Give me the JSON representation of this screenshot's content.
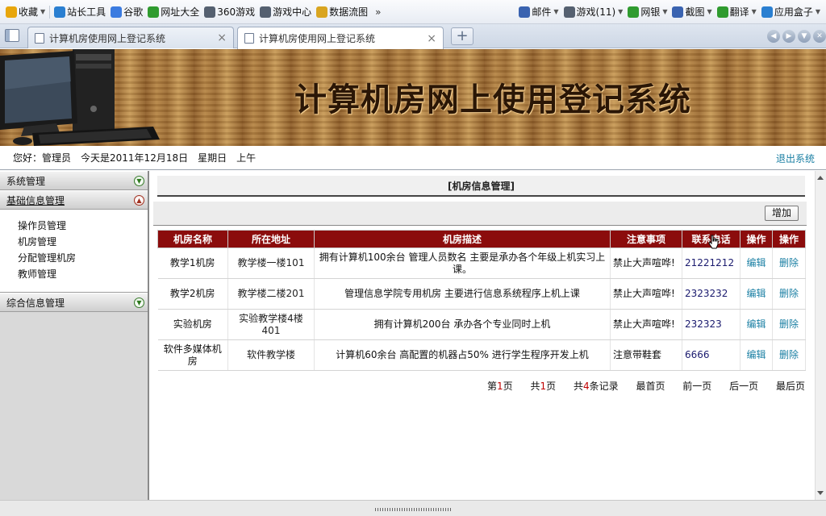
{
  "bookmarks": {
    "left": [
      {
        "label": "收藏",
        "icon": "star-icon",
        "color": "#e8a60c",
        "dropdown": true
      },
      {
        "label": "站长工具",
        "icon": "tool-icon",
        "color": "#2a7fd1",
        "dropdown": false
      },
      {
        "label": "谷歌",
        "icon": "google-icon",
        "color": "#3b7be0",
        "dropdown": false
      },
      {
        "label": "网址大全",
        "icon": "globe-icon",
        "color": "#2f9b2f",
        "dropdown": false
      },
      {
        "label": "360游戏",
        "icon": "gamepad-icon",
        "color": "#556070",
        "dropdown": false
      },
      {
        "label": "游戏中心",
        "icon": "gamepad-icon",
        "color": "#556070",
        "dropdown": false
      },
      {
        "label": "数据流图",
        "icon": "folder-icon",
        "color": "#d9a520",
        "dropdown": false
      }
    ],
    "more": "»",
    "right": [
      {
        "label": "邮件",
        "icon": "mail-icon",
        "color": "#3a63b0"
      },
      {
        "label": "游戏(11)",
        "icon": "gamepad-icon",
        "color": "#556070"
      },
      {
        "label": "网银",
        "icon": "bank-icon",
        "color": "#2f9b2f"
      },
      {
        "label": "截图",
        "icon": "scissors-icon",
        "color": "#3a63b0"
      },
      {
        "label": "翻译",
        "icon": "translate-icon",
        "color": "#2f9b2f"
      },
      {
        "label": "应用盒子",
        "icon": "box-icon",
        "color": "#2a7fd1"
      }
    ]
  },
  "tabs": [
    {
      "label": "计算机房使用网上登记系统",
      "active": false
    },
    {
      "label": "计算机房使用网上登记系统",
      "active": true
    }
  ],
  "tab_controls": {
    "new_tab": "+",
    "close": "×"
  },
  "banner": {
    "title": "计算机房网上使用登记系统"
  },
  "status": {
    "greeting": "您好：管理员",
    "date": "今天是2011年12月18日",
    "weekday": "星期日",
    "period": "上午",
    "logout": "退出系统"
  },
  "sidebar": {
    "sections": [
      {
        "label": "系统管理",
        "open": false
      },
      {
        "label": "基础信息管理",
        "open": true,
        "items": [
          "操作员管理",
          "机房管理",
          "分配管理机房",
          "教师管理"
        ]
      },
      {
        "label": "综合信息管理",
        "open": false
      }
    ]
  },
  "main": {
    "title": "[机房信息管理]",
    "add_button": "增加",
    "columns": [
      "机房名称",
      "所在地址",
      "机房描述",
      "注意事项",
      "联系电话",
      "操作",
      "操作"
    ],
    "rows": [
      {
        "name": "教学1机房",
        "address": "教学楼一楼101",
        "desc": "拥有计算机100余台  管理人员数名  主要是承办各个年级上机实习上课。",
        "note": "禁止大声喧哗!",
        "phone": "21221212",
        "edit": "编辑",
        "delete": "删除"
      },
      {
        "name": "教学2机房",
        "address": "教学楼二楼201",
        "desc": "管理信息学院专用机房  主要进行信息系统程序上机上课",
        "note": "禁止大声喧哗!",
        "phone": "2323232",
        "edit": "编辑",
        "delete": "删除"
      },
      {
        "name": "实验机房",
        "address": "实验教学楼4楼401",
        "desc": "拥有计算机200台  承办各个专业同时上机",
        "note": "禁止大声喧哗!",
        "phone": "232323",
        "edit": "编辑",
        "delete": "删除"
      },
      {
        "name": "软件多媒体机房",
        "address": "软件教学楼",
        "desc": "计算机60余台  高配置的机器占50% 进行学生程序开发上机",
        "note": "注意带鞋套",
        "phone": "6666",
        "edit": "编辑",
        "delete": "删除"
      }
    ],
    "pager": {
      "page_prefix": "第",
      "page_num": "1",
      "page_suffix": "页",
      "total_prefix": "共",
      "total_pages": "1",
      "total_suffix": "页",
      "records_prefix": "共",
      "records": "4",
      "records_suffix": "条记录",
      "first": "最首页",
      "prev": "前一页",
      "next": "后一页",
      "last": "最后页"
    }
  }
}
